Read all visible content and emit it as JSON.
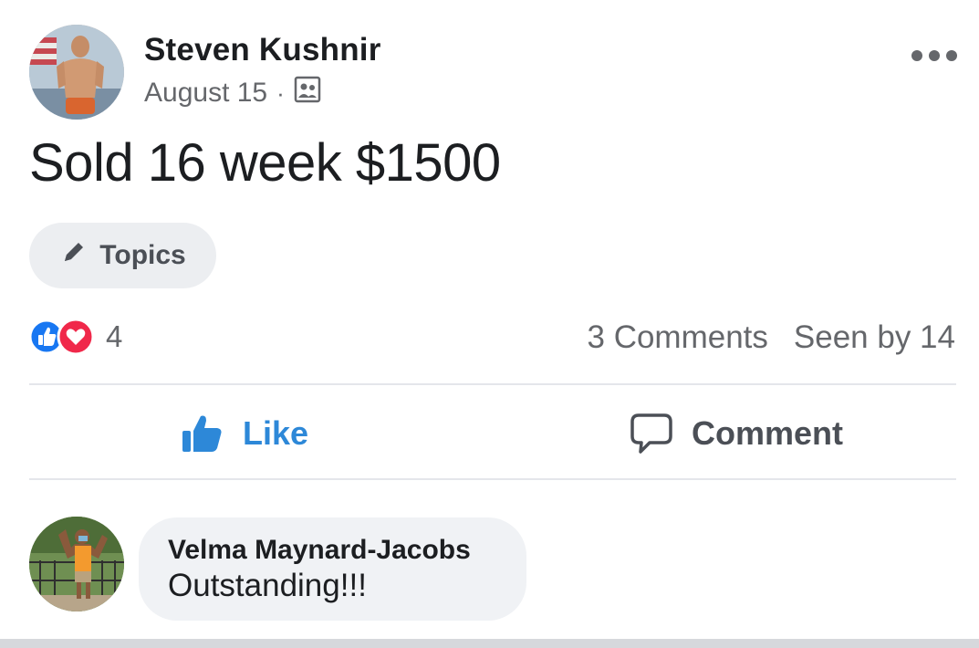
{
  "post": {
    "author": "Steven Kushnir",
    "date": "August 15",
    "separator": "·",
    "audience_icon": "group-audience-icon",
    "text": "Sold 16 week $1500",
    "topics_label": "Topics",
    "reactions": {
      "icons": [
        "like-reaction-icon",
        "love-reaction-icon"
      ],
      "count": "4"
    },
    "comments_count_label": "3 Comments",
    "seen_by_label": "Seen by 14"
  },
  "actions": {
    "like_label": "Like",
    "comment_label": "Comment"
  },
  "comments": [
    {
      "author": "Velma Maynard-Jacobs",
      "text": "Outstanding!!!"
    }
  ],
  "colors": {
    "like_blue": "#2d88d8",
    "love_red": "#f0284a",
    "muted_text": "#65676b",
    "chip_bg": "#eceef1",
    "bubble_bg": "#f0f2f5"
  }
}
